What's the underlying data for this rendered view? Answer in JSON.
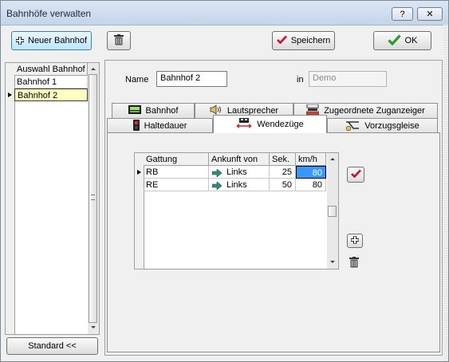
{
  "window": {
    "title": "Bahnhöfe verwalten",
    "help_label": "?",
    "close_label": "✕"
  },
  "toolbar": {
    "new_station_label": "Neuer Bahnhof",
    "save_label": "Speichern",
    "ok_label": "OK"
  },
  "station_list": {
    "header": "Auswahl Bahnhof",
    "items": [
      "Bahnhof 1",
      "Bahnhof 2"
    ],
    "selected_index": 1
  },
  "footer": {
    "standard_label": "Standard <<"
  },
  "form": {
    "name_label": "Name",
    "name_value": "Bahnhof 2",
    "in_label": "in",
    "in_value": "Demo"
  },
  "tabs": {
    "row1": [
      "Bahnhof",
      "Lautsprecher",
      "Zugeordnete Zuganzeiger"
    ],
    "row2": [
      "Haltedauer",
      "Wendezüge",
      "Vorzugsgleise"
    ],
    "active": "Wendezüge"
  },
  "table": {
    "columns": [
      "Gattung",
      "Ankunft von",
      "Sek.",
      "km/h"
    ],
    "rows": [
      {
        "gattung": "RB",
        "ankunft": "Links",
        "sek": "25",
        "kmh": "80",
        "selected": true
      },
      {
        "gattung": "RE",
        "ankunft": "Links",
        "sek": "50",
        "kmh": "80",
        "selected": false
      }
    ]
  },
  "colors": {
    "selected_cell": "#3399ff",
    "selected_list": "#ffffc0",
    "check_red": "#c8102e",
    "ok_green": "#2a9d2a"
  }
}
